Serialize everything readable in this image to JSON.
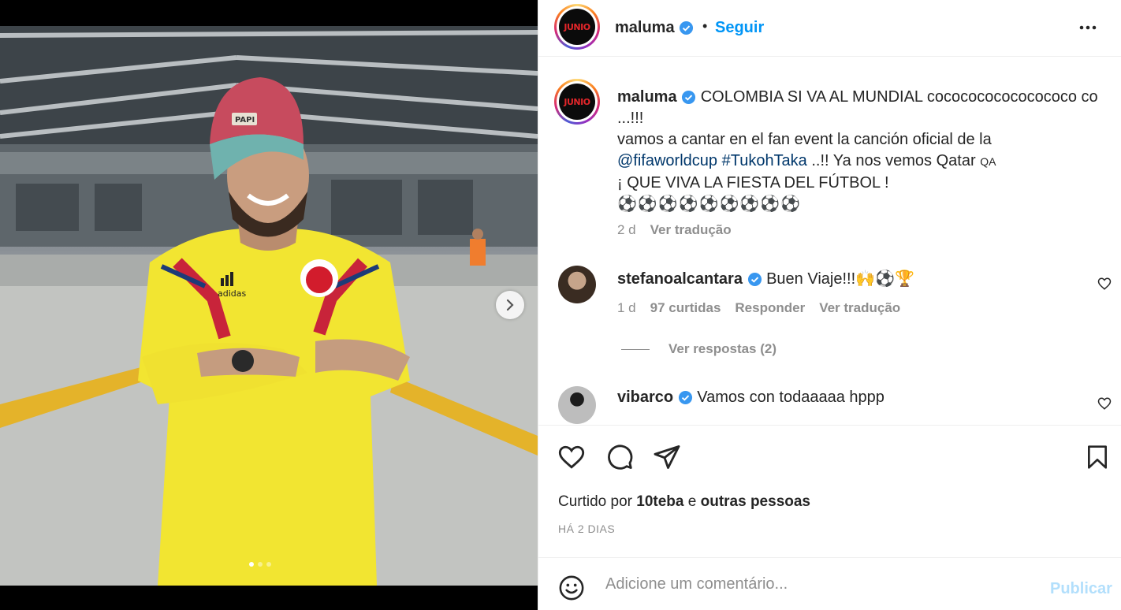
{
  "post": {
    "username": "maluma",
    "follow_label": "Seguir",
    "separator": "•",
    "avatar_text": "JUNIO"
  },
  "caption": {
    "username": "maluma",
    "line1": "COLOMBIA SI VA AL MUNDIAL cococococococococo co ...!!!",
    "line2": "vamos a cantar en el fan event la canción oficial de la",
    "mention": "@fifaworldcup",
    "hashtag": "#TukohTaka",
    "line3_tail": " ..!! Ya nos vemos Qatar",
    "flag_text": "QA",
    "line4": "¡ QUE VIVA LA FIESTA DEL FÚTBOL !",
    "balls": "⚽⚽⚽⚽⚽⚽⚽⚽⚽",
    "age": "2 d",
    "translate": "Ver tradução"
  },
  "comments": [
    {
      "username": "stefanoalcantara",
      "text": "Buen Viaje!!!🙌⚽🏆",
      "age": "1 d",
      "likes": "97 curtidas",
      "reply": "Responder",
      "translate": "Ver tradução",
      "view_replies": "Ver respostas (2)"
    },
    {
      "username": "vibarco",
      "text": "Vamos con todaaaaa hppp"
    }
  ],
  "likes": {
    "prefix": "Curtido por ",
    "user": "10teba",
    "conj": " e ",
    "others": "outras pessoas"
  },
  "timestamp": "HÁ 2 DIAS",
  "add_comment": {
    "placeholder": "Adicione um comentário...",
    "publish": "Publicar"
  },
  "media": {
    "cap_text": "PAPI",
    "jersey_brand": "adidas",
    "slides": 3,
    "active_slide": 1
  },
  "colors": {
    "link_blue": "#0095f6",
    "mention_blue": "#00376b",
    "verified_blue": "#3897f0",
    "jersey_yellow": "#f2e531"
  }
}
